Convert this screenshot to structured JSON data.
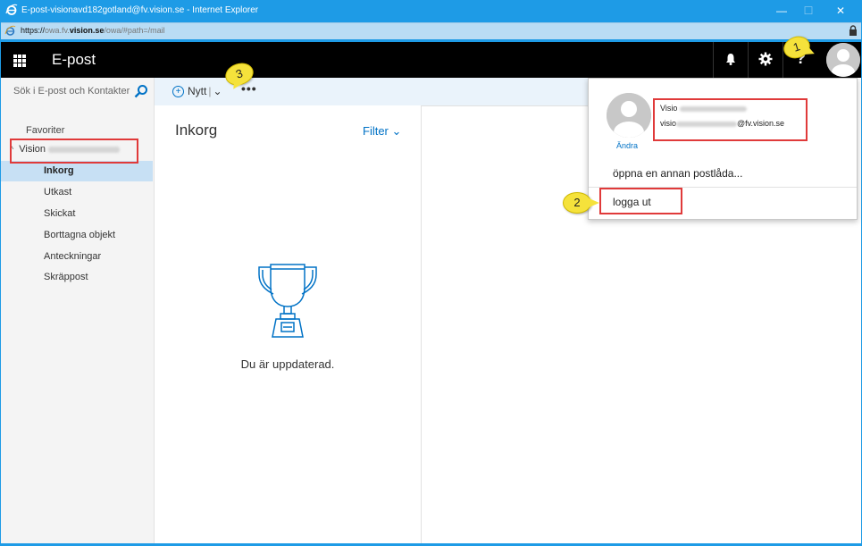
{
  "window": {
    "title": "E-post-visionavd182gotland@fv.vision.se - Internet Explorer",
    "minimize": "—",
    "maximize": "☐",
    "close": "✕"
  },
  "address": {
    "scheme": "https://",
    "pre_host": "owa.fv.",
    "host": "vision.se",
    "path": "/owa/#path=/mail"
  },
  "header": {
    "app_title": "E-post"
  },
  "sidebar": {
    "search_placeholder": "Sök i E-post och Kontakter",
    "favorites": "Favoriter",
    "account_prefix": "Vision",
    "folders": [
      {
        "label": "Inkorg"
      },
      {
        "label": "Utkast"
      },
      {
        "label": "Skickat"
      },
      {
        "label": "Borttagna objekt"
      },
      {
        "label": "Anteckningar"
      },
      {
        "label": "Skräppost"
      }
    ]
  },
  "toolbar": {
    "new_label": "Nytt",
    "new_sep": "|",
    "new_chevron": "⌄",
    "more": "•••"
  },
  "list": {
    "title": "Inkorg",
    "filter": "Filter",
    "filter_chevron": "⌄",
    "empty_message": "Du är uppdaterad."
  },
  "account_menu": {
    "name_prefix": "Visio",
    "email_prefix": "visio",
    "email_suffix": "@fv.vision.se",
    "change_label": "Ändra",
    "open_other_mailbox": "öppna en annan postlåda...",
    "logout": "logga ut"
  },
  "annotations": [
    {
      "number": "1"
    },
    {
      "number": "2"
    },
    {
      "number": "3"
    }
  ],
  "colors": {
    "ie_blue": "#1e9be6",
    "owa_header": "#000000",
    "accent": "#0072c6",
    "selected_folder": "#c7e0f4",
    "annotation_red": "#e03a3a",
    "callout_yellow": "#f5e23b"
  }
}
